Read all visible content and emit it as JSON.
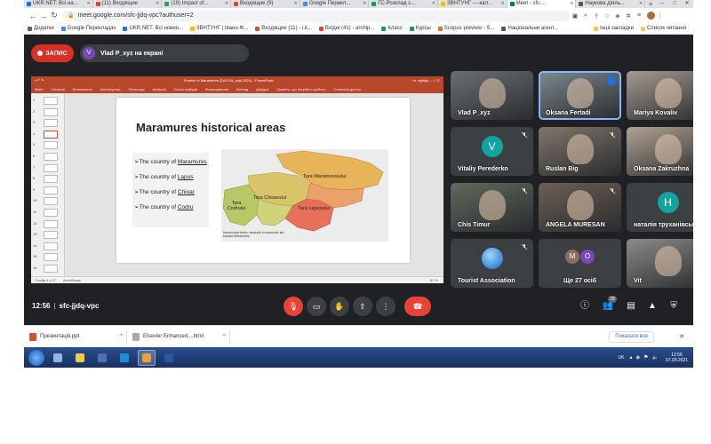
{
  "browser": {
    "tabs": [
      {
        "label": "UKR.NET: Всі на...",
        "color": "#1a73e8"
      },
      {
        "label": "(11) Входящие",
        "color": "#ea4335"
      },
      {
        "label": "(19) Impact of...",
        "color": "#21a366"
      },
      {
        "label": "Входящие (9)",
        "color": "#ea4335"
      },
      {
        "label": "Google Перекл...",
        "color": "#4285f4"
      },
      {
        "label": "ГС-Розклад з...",
        "color": "#0f9d58"
      },
      {
        "label": "ЗВНТУНГ — кал...",
        "color": "#fbbc04"
      },
      {
        "label": "Meet - sfc-...",
        "color": "#00832d",
        "active": true
      },
      {
        "label": "Наукова діяль...",
        "color": "#555555"
      }
    ],
    "new_tab": "+",
    "window_controls": {
      "minimize": "–",
      "maximize": "□",
      "close": "✕"
    },
    "url": "meet.google.com/sfc-jjdq-vpc?authuser=2",
    "bookmarks": [
      {
        "label": "Додатки",
        "color": "#5f6368"
      },
      {
        "label": "Google Перекладач",
        "color": "#4285f4"
      },
      {
        "label": "UKR.NET: Всі новин...",
        "color": "#1a73e8"
      },
      {
        "label": "ЗВНТУНГ | Івано-Ф...",
        "color": "#fbbc04"
      },
      {
        "label": "Входящие (11) - i.k...",
        "color": "#ea4335"
      },
      {
        "label": "Вхідні (41) - archip...",
        "color": "#ea4335"
      },
      {
        "label": "Класс",
        "color": "#0f9d58"
      },
      {
        "label": "Курсы",
        "color": "#0f9d58"
      },
      {
        "label": "Scopus preview - S...",
        "color": "#e9711c"
      },
      {
        "label": "Національне агент...",
        "color": "#555555"
      }
    ],
    "bookmarks_right": [
      "Інші закладки",
      "Список читання"
    ]
  },
  "meet": {
    "recording_label": "ЗАПИС",
    "presenter_initial": "V",
    "presenter_text": "Vlad P_xyz на екрані",
    "meeting_time": "12:56",
    "meeting_code": "sfc-jjdq-vpc",
    "participant_count": "29",
    "participants": [
      {
        "name": "Vlad P_xyz",
        "kind": "video",
        "bg": "#6b6f74",
        "muted": false
      },
      {
        "name": "Oksana Fertadi",
        "kind": "video",
        "bg": "#7c8a8f",
        "active": true
      },
      {
        "name": "Mariya Kovaliv",
        "kind": "video",
        "bg": "#a59b91",
        "muted": false
      },
      {
        "name": "Vitaliy Perederko",
        "kind": "letter",
        "letter": "V",
        "color": "#12a4a0",
        "muted": true
      },
      {
        "name": "Ruslan Big",
        "kind": "video",
        "bg": "#80766a",
        "muted": true
      },
      {
        "name": "Oksana Zakruzhna",
        "kind": "video",
        "bg": "#b0a392",
        "muted": true
      },
      {
        "name": "Chis Timur",
        "kind": "video",
        "bg": "#5f6a5c",
        "muted": true
      },
      {
        "name": "ANGELA MURESAN",
        "kind": "video",
        "bg": "#6d5f55",
        "muted": true
      },
      {
        "name": "наталія труханівська",
        "kind": "letter",
        "letter": "Н",
        "color": "#12a4a0",
        "muted": true
      },
      {
        "name": "Tourist Association",
        "kind": "logo",
        "muted": true
      },
      {
        "name": "Ще 27 осіб",
        "kind": "others",
        "initials": [
          "M",
          "O"
        ]
      },
      {
        "name": "Vit",
        "kind": "video",
        "bg": "#8c8b88",
        "muted": true
      }
    ]
  },
  "presentation": {
    "window_title": "Tourism in Maramures (EAO 05_sept 2021) - PowerPoint",
    "user": "m. гарбар",
    "menu": [
      "Файл",
      "Початок",
      "Вставлення",
      "Конструктор",
      "Переходи",
      "Анімації",
      "Показ слайдів",
      "Рецензування",
      "Вигляд",
      "Довідка",
      "Скажіть, що потрібно зробити",
      "Спільний доступ"
    ],
    "slide_title": "Maramures historical areas",
    "bullets": [
      {
        "prefix": "➢The country of ",
        "link": "Maramures"
      },
      {
        "prefix": "➢The country of ",
        "link": "Lapus"
      },
      {
        "prefix": "➢The country of ",
        "link": "Chioar"
      },
      {
        "prefix": "➢The country of ",
        "link": "Codru"
      }
    ],
    "map_labels": {
      "maramures": "Tara Maramuresului",
      "codru": "Tara Codrului",
      "chioar": "Tara Chioarului",
      "lapus": "Tara Lapusului"
    },
    "map_caption": "Maramureș istoric: ținuturile și comunele ale fostului Maramureș",
    "thumbs_count": 16,
    "selected_slide": 4,
    "notes_placeholder": "Клацніть, щоб додати нотатки",
    "status_left": "Слайд 4 з 27",
    "status_lang": "Англійська",
    "zoom": "61 %"
  },
  "downloads": [
    {
      "name": "Презентація.ppt",
      "color": "#d35230"
    },
    {
      "name": "Elsevier Enhanced....html",
      "color": "#aaaaaa"
    }
  ],
  "downloads_show_all": "Показати все",
  "taskbar": {
    "apps": [
      {
        "color": "#8fb4e6"
      },
      {
        "color": "#f2c94c"
      },
      {
        "color": "#4f6fb3"
      },
      {
        "color": "#1d8ed6"
      },
      {
        "color": "#e6a23c",
        "on": true
      },
      {
        "color": "#2b579a"
      }
    ],
    "lang": "UK",
    "time": "12:56",
    "date": "07.09.2021"
  }
}
